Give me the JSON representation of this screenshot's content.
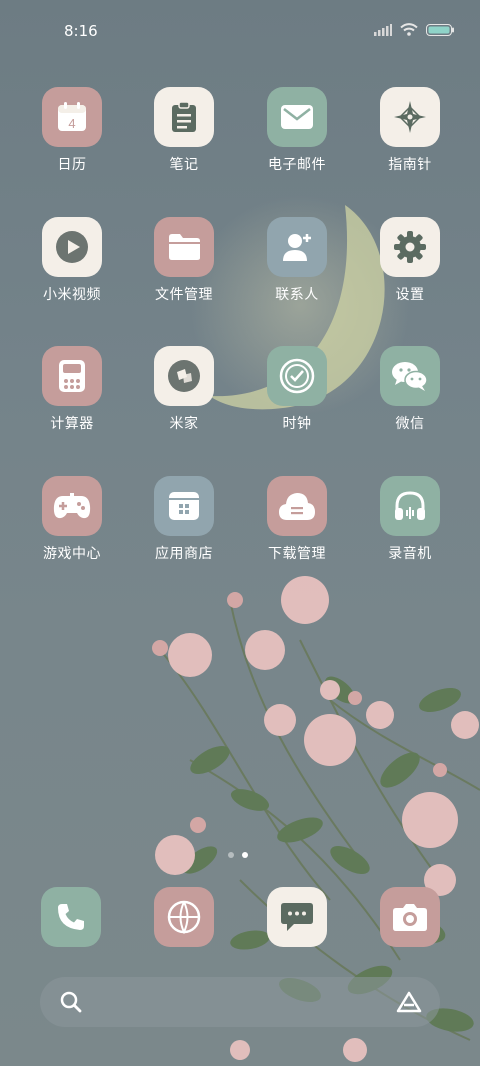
{
  "status_bar": {
    "time": "8:16",
    "signal_icon": "signal-icon",
    "wifi_icon": "wifi-icon",
    "battery_icon": "battery-icon"
  },
  "apps": [
    {
      "label": "日历",
      "icon": "calendar-icon",
      "calendar_day": "4"
    },
    {
      "label": "笔记",
      "icon": "notes-icon"
    },
    {
      "label": "电子邮件",
      "icon": "mail-icon"
    },
    {
      "label": "指南针",
      "icon": "compass-icon"
    },
    {
      "label": "小米视频",
      "icon": "play-icon"
    },
    {
      "label": "文件管理",
      "icon": "folder-icon"
    },
    {
      "label": "联系人",
      "icon": "contacts-icon"
    },
    {
      "label": "设置",
      "icon": "gear-icon"
    },
    {
      "label": "计算器",
      "icon": "calculator-icon"
    },
    {
      "label": "米家",
      "icon": "mijia-icon"
    },
    {
      "label": "时钟",
      "icon": "clock-icon"
    },
    {
      "label": "微信",
      "icon": "wechat-icon"
    },
    {
      "label": "游戏中心",
      "icon": "gamepad-icon"
    },
    {
      "label": "应用商店",
      "icon": "app-store-icon"
    },
    {
      "label": "下载管理",
      "icon": "download-cloud-icon"
    },
    {
      "label": "录音机",
      "icon": "headphones-icon"
    }
  ],
  "page_indicator": {
    "count": 2,
    "active": 2
  },
  "dock": [
    {
      "icon": "phone-icon"
    },
    {
      "icon": "browser-icon"
    },
    {
      "icon": "messages-icon"
    },
    {
      "icon": "camera-icon"
    }
  ],
  "search_bar": {
    "left_icon": "search-icon",
    "right_icon": "assistant-icon"
  },
  "colors": {
    "pink": "#c59d9b",
    "cream": "#f4efe8",
    "green": "#8fb1a3",
    "blue": "#91a5ae"
  }
}
